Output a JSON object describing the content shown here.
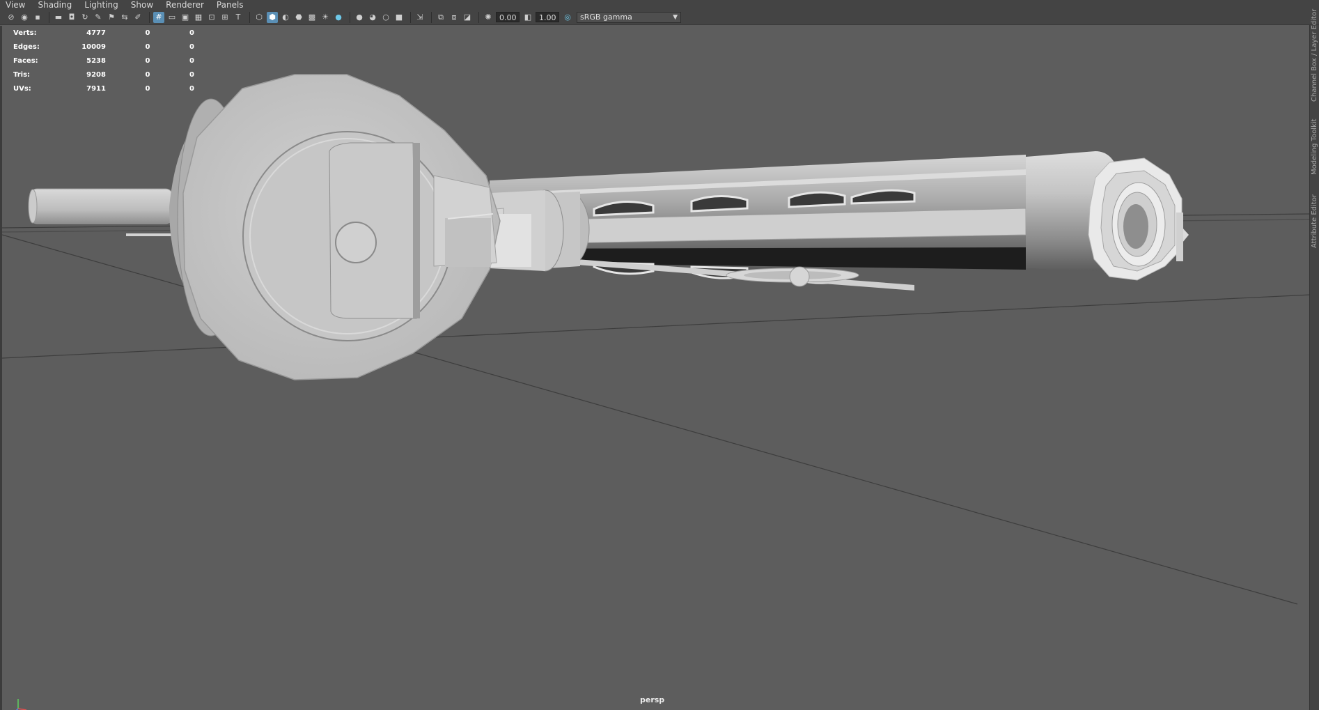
{
  "menu": [
    "View",
    "Shading",
    "Lighting",
    "Show",
    "Renderer",
    "Panels"
  ],
  "toolbar": {
    "icons": [
      "select-camera-icon",
      "camera-attributes-icon",
      "bookmark-icon",
      "image-plane-icon",
      "camera-icon",
      "two-d-pan-zoom-icon",
      "grease-pencil-icon",
      "grid-icon",
      "film-gate-icon",
      "resolution-gate-icon",
      "gate-mask-icon",
      "field-chart-icon",
      "safe-action-icon",
      "safe-title-icon",
      "wireframe-icon",
      "smooth-shade-icon",
      "default-material-icon",
      "wireframe-on-shaded-icon",
      "textured-icon",
      "use-all-lights-icon",
      "shadows-icon",
      "screen-space-ao-icon",
      "motion-blur-icon",
      "multisample-aa-icon",
      "depth-of-field-icon",
      "isolate-select-icon",
      "xray-icon",
      "xray-joints-icon",
      "backface-culling-icon",
      "exposure-icon",
      "gamma-icon",
      "color-management-icon"
    ],
    "exposure_value": "0.00",
    "gamma_value": "1.00",
    "view_transform": "sRGB gamma"
  },
  "hud": {
    "rows": [
      {
        "label": "Verts:",
        "v1": "4777",
        "v2": "0",
        "v3": "0"
      },
      {
        "label": "Edges:",
        "v1": "10009",
        "v2": "0",
        "v3": "0"
      },
      {
        "label": "Faces:",
        "v1": "5238",
        "v2": "0",
        "v3": "0"
      },
      {
        "label": "Tris:",
        "v1": "9208",
        "v2": "0",
        "v3": "0"
      },
      {
        "label": "UVs:",
        "v1": "7911",
        "v2": "0",
        "v3": "0"
      }
    ]
  },
  "camera_label": "persp",
  "side_tabs": [
    "Channel Box / Layer Editor",
    "Modeling Toolkit",
    "Attribute Editor"
  ],
  "colors": {
    "viewport_bg": "#5d5d5d",
    "ui_bg": "#444444",
    "accent": "#5a8fb5",
    "model_light": "#c8c8c8"
  }
}
